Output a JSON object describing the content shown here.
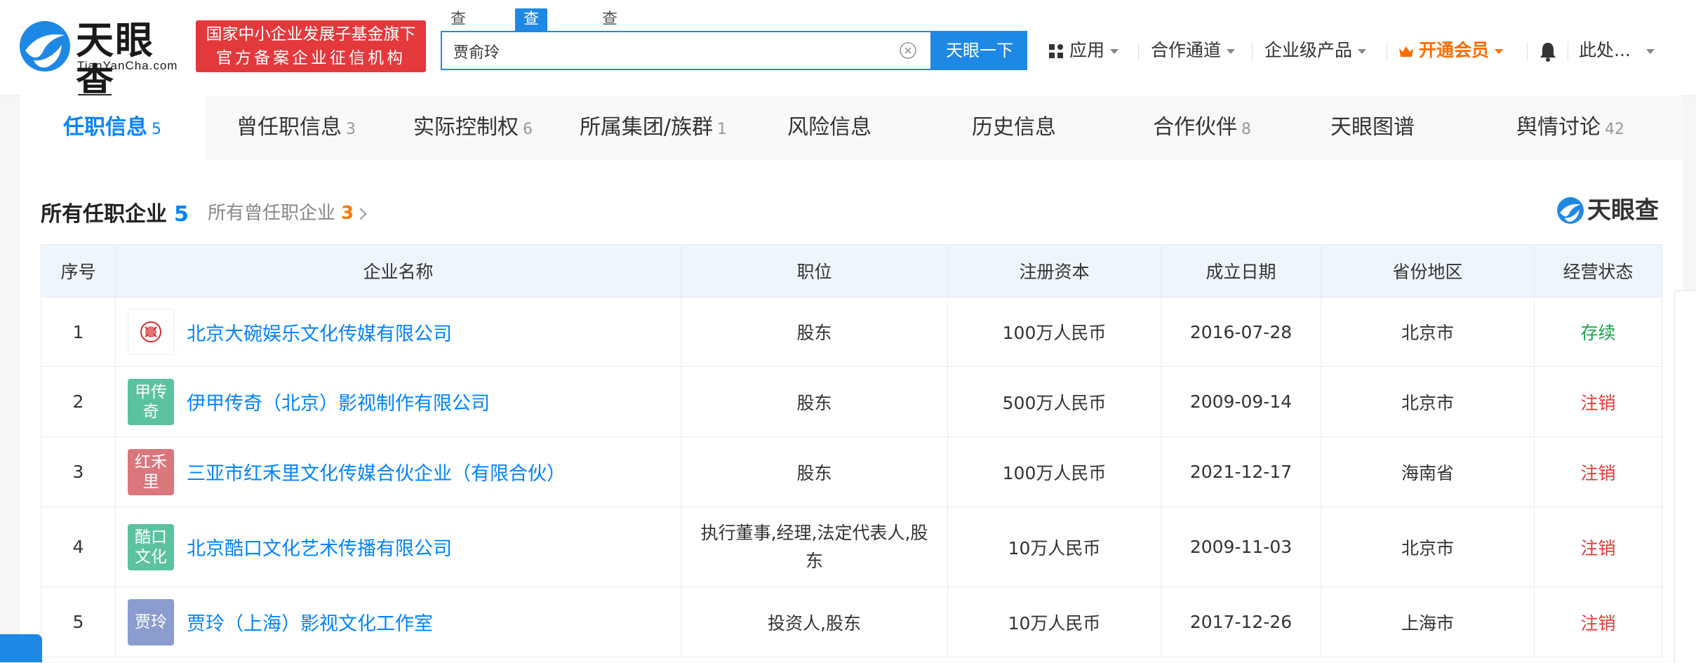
{
  "header": {
    "logo_text": "天眼查",
    "logo_sub": "TianYanCha.com",
    "banner_line1": "国家中小企业发展子基金旗下",
    "banner_line2": "官方备案企业征信机构",
    "search_tabs": [
      "查公司",
      "查老板",
      "查关系"
    ],
    "search_value": "贾俞玲",
    "search_button": "天眼一下",
    "nav": {
      "apps": "应用",
      "cooperation": "合作通道",
      "enterprise": "企业级产品",
      "vip": "开通会员",
      "user": "此处..."
    }
  },
  "tabs": [
    {
      "label": "任职信息",
      "count": "5"
    },
    {
      "label": "曾任职信息",
      "count": "3"
    },
    {
      "label": "实际控制权",
      "count": "6"
    },
    {
      "label": "所属集团/族群",
      "count": "1"
    },
    {
      "label": "风险信息",
      "count": ""
    },
    {
      "label": "历史信息",
      "count": ""
    },
    {
      "label": "合作伙伴",
      "count": "8"
    },
    {
      "label": "天眼图谱",
      "count": ""
    },
    {
      "label": "舆情讨论",
      "count": "42"
    }
  ],
  "section": {
    "title": "所有任职企业",
    "title_count": "5",
    "sub": "所有曾任职企业",
    "sub_count": "3",
    "watermark": "天眼查"
  },
  "table": {
    "headers": [
      "序号",
      "企业名称",
      "职位",
      "注册资本",
      "成立日期",
      "省份地区",
      "经营状态"
    ],
    "rows": [
      {
        "no": "1",
        "logo": "",
        "logo_color": "#ffffff",
        "name": "北京大碗娱乐文化传媒有限公司",
        "position": "股东",
        "capital": "100万人民币",
        "date": "2016-07-28",
        "region": "北京市",
        "status": "存续",
        "status_color": "#1aa34a"
      },
      {
        "no": "2",
        "logo": "甲传奇",
        "logo_color": "#5bc2a0",
        "name": "伊甲传奇（北京）影视制作有限公司",
        "position": "股东",
        "capital": "500万人民币",
        "date": "2009-09-14",
        "region": "北京市",
        "status": "注销",
        "status_color": "#e53935"
      },
      {
        "no": "3",
        "logo": "红禾里",
        "logo_color": "#d9777c",
        "name": "三亚市红禾里文化传媒合伙企业（有限合伙）",
        "position": "股东",
        "capital": "100万人民币",
        "date": "2021-12-17",
        "region": "海南省",
        "status": "注销",
        "status_color": "#e53935"
      },
      {
        "no": "4",
        "logo": "酷口文化",
        "logo_color": "#5bc2a0",
        "name": "北京酷口文化艺术传播有限公司",
        "position": "执行董事,经理,法定代表人,股东",
        "capital": "10万人民币",
        "date": "2009-11-03",
        "region": "北京市",
        "status": "注销",
        "status_color": "#e53935"
      },
      {
        "no": "5",
        "logo": "贾玲",
        "logo_color": "#8b9ccf",
        "name": "贾玲（上海）影视文化工作室",
        "position": "投资人,股东",
        "capital": "10万人民币",
        "date": "2017-12-26",
        "region": "上海市",
        "status": "注销",
        "status_color": "#e53935"
      }
    ]
  },
  "colors": {
    "brand_blue": "#1e88e5",
    "link_blue": "#0084ff",
    "banner_red": "#e4393c",
    "vip_orange": "#ff6d00"
  }
}
